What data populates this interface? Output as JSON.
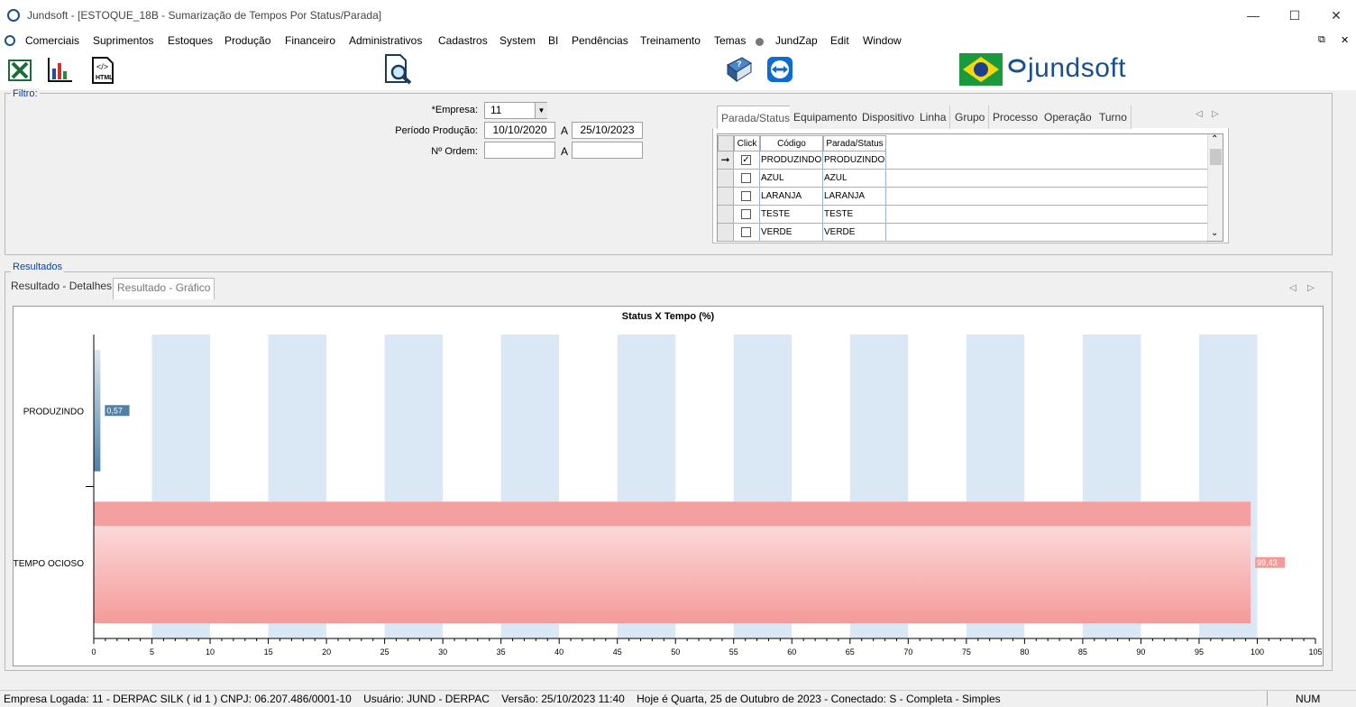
{
  "window": {
    "title": "Jundsoft - [ESTOQUE_18B - Sumarização de Tempos Por Status/Parada]",
    "minimize": "—",
    "maximize": "☐",
    "close": "✕"
  },
  "menu": [
    "Comerciais",
    "Suprimentos",
    "Estoques",
    "Produção",
    "Financeiro",
    "Administrativos",
    "Cadastros",
    "System",
    "BI",
    "Pendências",
    "Treinamento",
    "Temas",
    "JundZap",
    "Edit",
    "Window"
  ],
  "brand": {
    "logo_text": "jundsoft",
    "accent": "#1a4f8a"
  },
  "filter": {
    "group_label": "Filtro:",
    "empresa_label": "*Empresa:",
    "empresa_value": "11",
    "periodo_label": "Período Produção:",
    "periodo_from": "10/10/2020",
    "periodo_sep": "A",
    "periodo_to": "25/10/2023",
    "ordem_label": "Nº Ordem:",
    "ordem_sep": "A",
    "ordem_from": "",
    "ordem_to": ""
  },
  "filter_tabs": [
    "Parada/Status",
    "Equipamento",
    "Dispositivo",
    "Linha",
    "Grupo",
    "Processo",
    "Operação",
    "Turno"
  ],
  "grid": {
    "headers": [
      "Click",
      "Código",
      "Parada/Status"
    ],
    "rows": [
      {
        "checked": true,
        "codigo": "PRODUZINDO",
        "status": "PRODUZINDO",
        "current": true
      },
      {
        "checked": false,
        "codigo": "AZUL",
        "status": "AZUL"
      },
      {
        "checked": false,
        "codigo": "LARANJA",
        "status": "LARANJA"
      },
      {
        "checked": false,
        "codigo": "TESTE",
        "status": "TESTE"
      },
      {
        "checked": false,
        "codigo": "VERDE",
        "status": "VERDE"
      }
    ]
  },
  "results": {
    "group_label": "Resultados",
    "tabs": [
      "Resultado - Detalhes",
      "Resultado - Gráfico"
    ]
  },
  "chart_data": {
    "type": "bar",
    "orientation": "horizontal",
    "title": "Status X Tempo (%)",
    "categories": [
      "PRODUZINDO",
      "TEMPO OCIOSO"
    ],
    "values": [
      0.57,
      99.43
    ],
    "value_labels": [
      "0,57",
      "99,43"
    ],
    "colors": [
      "#4f81a8",
      "#f59a9a"
    ],
    "xlim": [
      0,
      105
    ],
    "x_ticks": [
      "0",
      "5",
      "10",
      "15",
      "20",
      "25",
      "30",
      "35",
      "40",
      "45",
      "50",
      "55",
      "60",
      "65",
      "70",
      "75",
      "80",
      "85",
      "90",
      "95",
      "100",
      "105"
    ]
  },
  "status": {
    "text": "Empresa Logada: 11 - DERPAC SILK ( id 1 ) CNPJ: 06.207.486/0001-10    Usuário: JUND - DERPAC    Versão: 25/10/2023 11:40    Hoje é Quarta, 25 de Outubro de 2023 - Conectado: S - Completa - Simples",
    "num": "NUM"
  }
}
